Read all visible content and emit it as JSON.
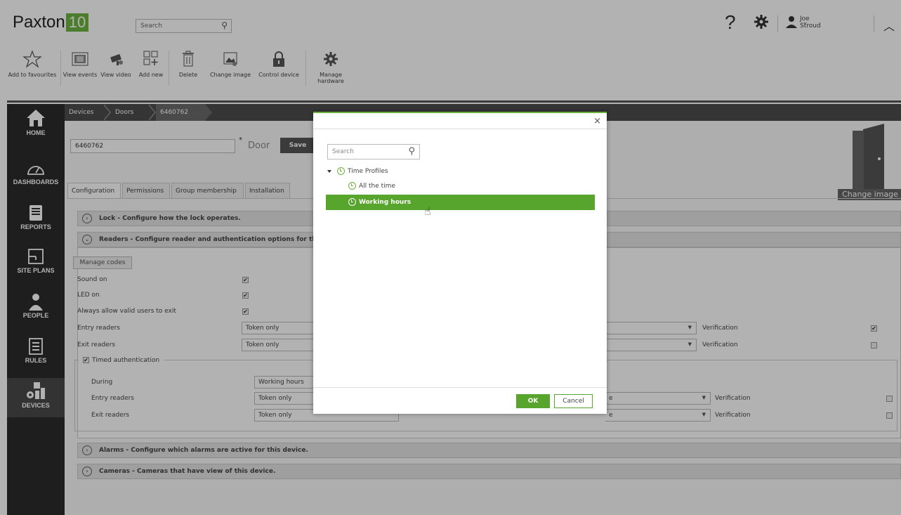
{
  "app": {
    "logo_text": "Paxton",
    "logo_number": "10",
    "search_placeholder": "Search",
    "help_label": "?",
    "user_name": "Joe Stroud"
  },
  "toolbar": {
    "items": [
      {
        "label": "Add to favourites",
        "icon": "star-icon"
      },
      {
        "label": "View events",
        "icon": "events-icon"
      },
      {
        "label": "View video",
        "icon": "camera-icon"
      },
      {
        "label": "Add new",
        "icon": "add-new-icon"
      },
      {
        "label": "Delete",
        "icon": "trash-icon"
      },
      {
        "label": "Change image",
        "icon": "image-icon"
      },
      {
        "label": "Control device",
        "icon": "lock-icon"
      },
      {
        "label": "Manage",
        "label2": "hardware",
        "icon": "gear-icon"
      }
    ]
  },
  "nav": {
    "items": [
      {
        "label": "HOME",
        "icon": "home-icon"
      },
      {
        "label": "DASHBOARDS",
        "icon": "dashboard-icon"
      },
      {
        "label": "REPORTS",
        "icon": "reports-icon"
      },
      {
        "label": "SITE PLANS",
        "icon": "siteplans-icon"
      },
      {
        "label": "PEOPLE",
        "icon": "person-icon"
      },
      {
        "label": "RULES",
        "icon": "rules-icon"
      },
      {
        "label": "DEVICES",
        "icon": "devices-icon"
      }
    ]
  },
  "breadcrumb": [
    "Devices",
    "Doors",
    "6460762"
  ],
  "device": {
    "name": "6460762",
    "required_mark": "*",
    "type": "Door",
    "save_label": "Save",
    "change_image_label": "Change image"
  },
  "tabs": [
    "Configuration",
    "Permissions",
    "Group membership",
    "Installation"
  ],
  "sections": {
    "lock": "Lock - Configure how the lock operates.",
    "readers": "Readers - Configure reader and authentication options for this de",
    "alarms": "Alarms - Configure which alarms are active for this device.",
    "cameras": "Cameras - Cameras that have view of this device."
  },
  "readers": {
    "manage_codes": "Manage codes",
    "sound_on": "Sound on",
    "led_on": "LED on",
    "always_allow": "Always allow valid users to exit",
    "entry_readers": "Entry readers",
    "exit_readers": "Exit readers",
    "entry_value": "Token only",
    "exit_value": "Token only",
    "verification": "Verification",
    "timed_auth": "Timed authentication",
    "during": "During",
    "during_value": "Working hours",
    "timed_entry": "Entry readers",
    "timed_exit": "Exit readers",
    "timed_entry_value": "Token only",
    "timed_exit_value": "Token only",
    "timed_second_value": "e",
    "check_mark": "✔"
  },
  "dialog": {
    "close": "×",
    "search_placeholder": "Search",
    "root": "Time Profiles",
    "items": [
      "All the time",
      "Working hours"
    ],
    "ok": "OK",
    "cancel": "Cancel"
  },
  "colors": {
    "accent": "#6db33f",
    "selected": "#57a52c",
    "nav_bg": "#2b2b2b"
  }
}
